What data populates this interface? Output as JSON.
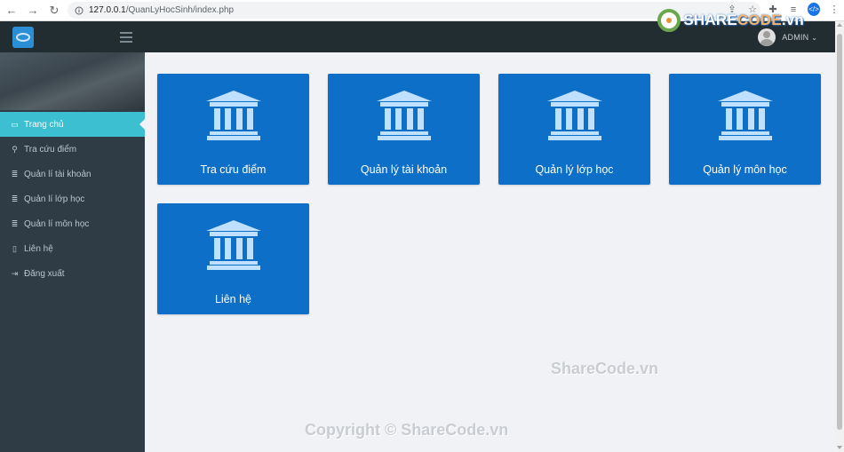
{
  "browser": {
    "url_host": "127.0.0.1",
    "url_path": "/QuanLyHocSinh/index.php",
    "back_icon": "arrow-left-icon",
    "forward_icon": "arrow-right-icon",
    "reload_icon": "reload-icon"
  },
  "watermark": {
    "logo_text_a": "SHARE",
    "logo_text_b": "CODE",
    "logo_text_c": ".vn",
    "mid": "ShareCode.vn",
    "bottom": "Copyright © ShareCode.vn"
  },
  "header": {
    "user_name": "ADMIN"
  },
  "sidebar": {
    "items": [
      {
        "label": "Trang chủ",
        "icon": "monitor-icon",
        "glyph": "▭",
        "active": true
      },
      {
        "label": "Tra cứu điểm",
        "icon": "search-icon",
        "glyph": "⚲",
        "active": false
      },
      {
        "label": "Quản lí tài khoản",
        "icon": "list-icon",
        "glyph": "≣",
        "active": false
      },
      {
        "label": "Quản lí lớp học",
        "icon": "list-icon",
        "glyph": "≣",
        "active": false
      },
      {
        "label": "Quản lí môn học",
        "icon": "list-icon",
        "glyph": "≣",
        "active": false
      },
      {
        "label": "Liên hệ",
        "icon": "file-icon",
        "glyph": "▯",
        "active": false
      },
      {
        "label": "Đăng xuất",
        "icon": "sign-out-icon",
        "glyph": "⇥",
        "active": false
      }
    ]
  },
  "main": {
    "cards": [
      {
        "label": "Tra cứu điểm",
        "icon": "bank-icon"
      },
      {
        "label": "Quản lý tài khoản",
        "icon": "bank-icon"
      },
      {
        "label": "Quản lý lớp học",
        "icon": "bank-icon"
      },
      {
        "label": "Quản lý môn học",
        "icon": "bank-icon"
      },
      {
        "label": "Liên hệ",
        "icon": "bank-icon"
      }
    ]
  },
  "colors": {
    "accent": "#3cbfd0",
    "card": "#0d6fc7",
    "sidebar": "#2f3b45",
    "topbar": "#222d32"
  }
}
